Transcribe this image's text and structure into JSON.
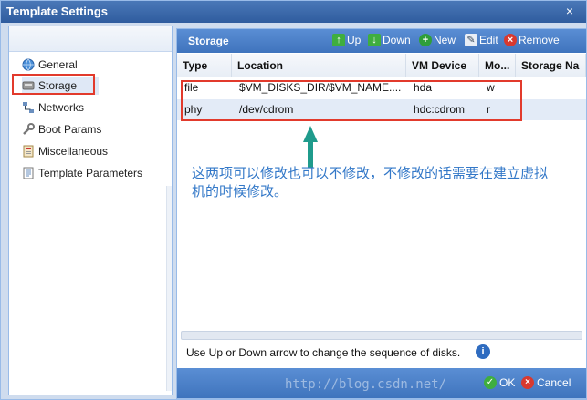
{
  "window": {
    "title": "Template Settings",
    "close_glyph": "×"
  },
  "sidebar": {
    "items": [
      {
        "label": "General",
        "icon": "globe-icon"
      },
      {
        "label": "Storage",
        "icon": "disk-icon"
      },
      {
        "label": "Networks",
        "icon": "network-icon"
      },
      {
        "label": "Boot Params",
        "icon": "wrench-icon"
      },
      {
        "label": "Miscellaneous",
        "icon": "misc-icon"
      },
      {
        "label": "Template Parameters",
        "icon": "doc-icon"
      }
    ]
  },
  "panel": {
    "title": "Storage",
    "toolbar": {
      "up": "Up",
      "down": "Down",
      "new": "New",
      "edit": "Edit",
      "remove": "Remove"
    },
    "columns": [
      "Type",
      "Location",
      "VM Device",
      "Mo...",
      "Storage Na"
    ],
    "rows": [
      {
        "type": "file",
        "location": "$VM_DISKS_DIR/$VM_NAME....",
        "device": "hda",
        "mode": "w"
      },
      {
        "type": "phy",
        "location": "/dev/cdrom",
        "device": "hdc:cdrom",
        "mode": "r"
      }
    ],
    "annotation": "这两项可以修改也可以不修改，不修改的话需要在建立虚拟机的时候修改。",
    "hint": "Use Up or Down arrow to change the sequence of disks.",
    "info_glyph": "i",
    "footer": {
      "ok": "OK",
      "cancel": "Cancel"
    },
    "watermark": "http://blog.csdn.net/"
  },
  "colors": {
    "accent": "#3f74bd",
    "annotation": "#3378c8",
    "highlight": "#e23a2c",
    "arrow": "#1f9b8c"
  }
}
